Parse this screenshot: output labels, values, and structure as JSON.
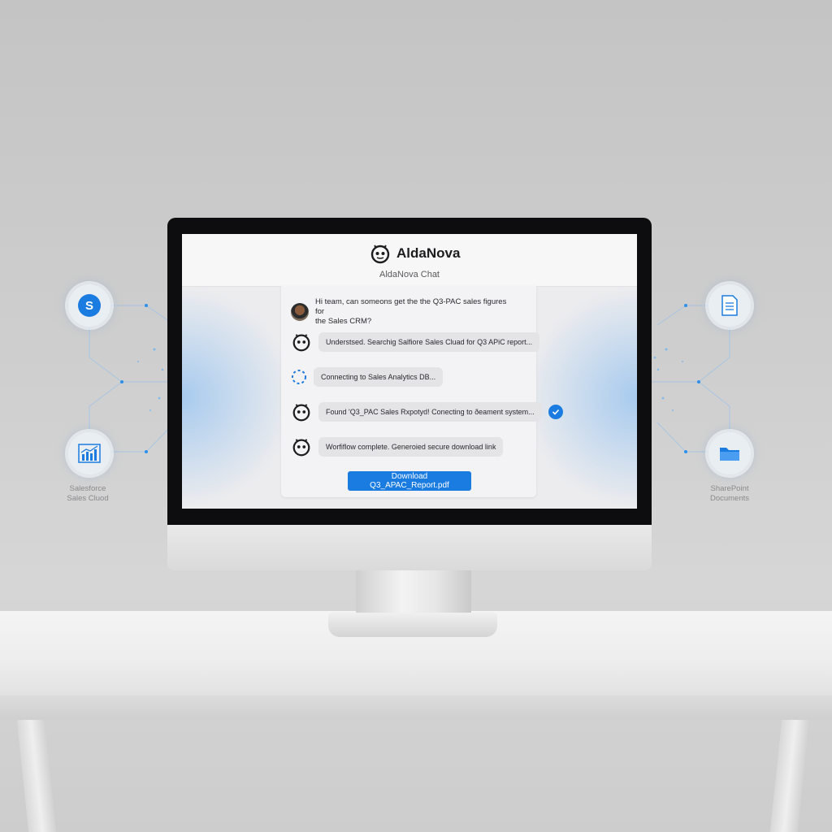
{
  "app": {
    "name": "AldaNova",
    "subtitle": "AldaNova Chat"
  },
  "messages": [
    {
      "sender": "user",
      "text_line1": "Hi team, can someons get the the Q3-PAC sales figures for",
      "text_line2": "the Sales CRM?"
    },
    {
      "sender": "bot",
      "text": "Understsed. Searchig Salfiore Sales Cluad for Q3 APiC report..."
    },
    {
      "sender": "system",
      "text": "Connecting to Sales Analytics DB..."
    },
    {
      "sender": "bot",
      "text": "Found 'Q3_PAC Sales Rxpotyd! Conecting to ðeament system...",
      "status": "done"
    },
    {
      "sender": "bot",
      "text": "Worfiflow complete. Generoied secure download link"
    }
  ],
  "download_button": "Download Q3_APAC_Report.pdf",
  "integrations": {
    "left_label_line1": "Salesforce",
    "left_label_line2": "Sales Cluod",
    "right_label_line1": "SharePoint",
    "right_label_line2": "Documents",
    "left_top_letter": "S"
  },
  "colors": {
    "accent": "#1a7be0",
    "bubble": "#e4e4e7",
    "glow": "#3d9bf0"
  }
}
